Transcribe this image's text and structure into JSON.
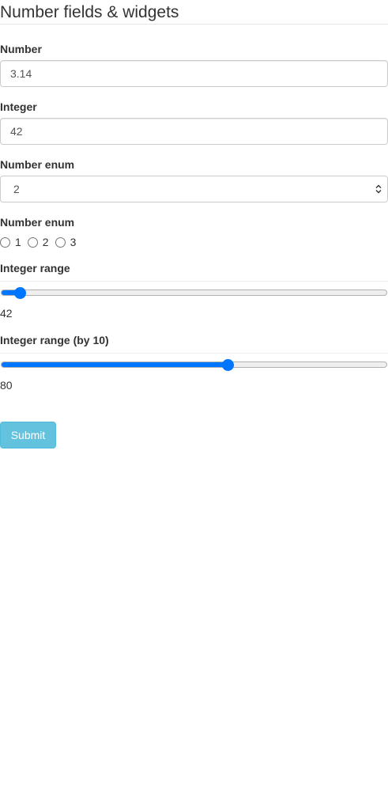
{
  "form": {
    "title": "Number fields & widgets",
    "number": {
      "label": "Number",
      "value": "3.14"
    },
    "integer": {
      "label": "Integer",
      "value": "42"
    },
    "number_enum_select": {
      "label": "Number enum",
      "selected": "2"
    },
    "number_enum_radio": {
      "label": "Number enum",
      "options": [
        "1",
        "2",
        "3"
      ],
      "selected": null
    },
    "integer_range": {
      "label": "Integer range",
      "value": "42",
      "fill_percent": 3.5
    },
    "integer_range_by10": {
      "label": "Integer range (by 10)",
      "value": "80",
      "fill_percent": 59
    },
    "submit_label": "Submit"
  },
  "colors": {
    "accent": "#0075ff",
    "button": "#5bc0de"
  },
  "icons": {
    "select_arrow": "chevron-updown-icon"
  }
}
